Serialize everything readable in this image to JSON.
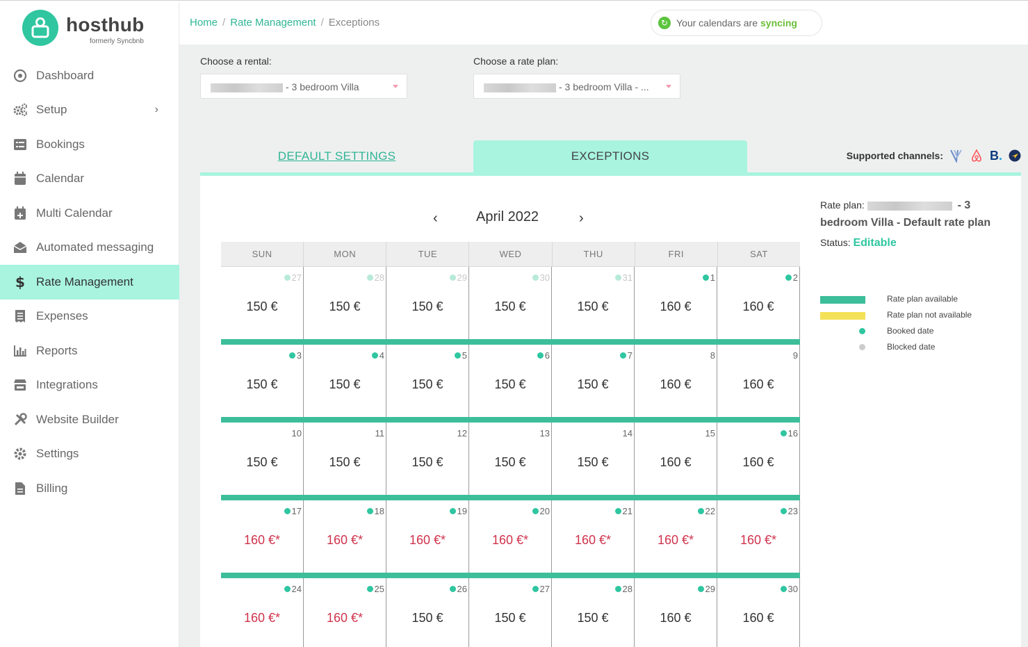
{
  "brand": {
    "name": "hosthub",
    "subtitle": "formerly Syncbnb",
    "accent": "#2fc6a0"
  },
  "sidebar": {
    "items": [
      {
        "label": "Dashboard",
        "icon": "dashboard-icon"
      },
      {
        "label": "Setup",
        "icon": "gears-icon"
      },
      {
        "label": "Bookings",
        "icon": "list-icon"
      },
      {
        "label": "Calendar",
        "icon": "calendar-icon"
      },
      {
        "label": "Multi Calendar",
        "icon": "calendar-plus-icon"
      },
      {
        "label": "Automated messaging",
        "icon": "envelope-icon"
      },
      {
        "label": "Rate Management",
        "icon": "dollar-icon"
      },
      {
        "label": "Expenses",
        "icon": "receipt-icon"
      },
      {
        "label": "Reports",
        "icon": "bar-chart-icon"
      },
      {
        "label": "Integrations",
        "icon": "store-icon"
      },
      {
        "label": "Website Builder",
        "icon": "tools-icon"
      },
      {
        "label": "Settings",
        "icon": "gear-icon"
      },
      {
        "label": "Billing",
        "icon": "file-icon"
      }
    ],
    "active": "Rate Management"
  },
  "header": {
    "breadcrumb": [
      "Home",
      "Rate Management",
      "Exceptions"
    ],
    "sync_text": "Your calendars are",
    "sync_word": "syncing"
  },
  "filters": {
    "rental_label": "Choose a rental:",
    "rental_value": "- 3 bedroom Villa",
    "rateplan_label": "Choose a rate plan:",
    "rateplan_value": "- 3 bedroom Villa - ..."
  },
  "tabs": {
    "default": "DEFAULT SETTINGS",
    "exceptions": "EXCEPTIONS",
    "active": "EXCEPTIONS"
  },
  "channels": {
    "label": "Supported channels:",
    "icons": [
      "vrbo-icon",
      "airbnb-icon",
      "booking-icon",
      "expedia-icon"
    ]
  },
  "calendar": {
    "month": "April 2022",
    "weekdays": [
      "SUN",
      "MON",
      "TUE",
      "WED",
      "THU",
      "FRI",
      "SAT"
    ],
    "weeks": [
      [
        {
          "d": "27",
          "p": "150 €",
          "dot": true,
          "faded": true
        },
        {
          "d": "28",
          "p": "150 €",
          "dot": true,
          "faded": true
        },
        {
          "d": "29",
          "p": "150 €",
          "dot": true,
          "faded": true
        },
        {
          "d": "30",
          "p": "150 €",
          "dot": true,
          "faded": true
        },
        {
          "d": "31",
          "p": "150 €",
          "dot": true,
          "faded": true
        },
        {
          "d": "1",
          "p": "160 €",
          "dot": true
        },
        {
          "d": "2",
          "p": "160 €",
          "dot": true
        }
      ],
      [
        {
          "d": "3",
          "p": "150 €",
          "dot": true
        },
        {
          "d": "4",
          "p": "150 €",
          "dot": true
        },
        {
          "d": "5",
          "p": "150 €",
          "dot": true
        },
        {
          "d": "6",
          "p": "150 €",
          "dot": true
        },
        {
          "d": "7",
          "p": "150 €",
          "dot": true
        },
        {
          "d": "8",
          "p": "160 €"
        },
        {
          "d": "9",
          "p": "160 €"
        }
      ],
      [
        {
          "d": "10",
          "p": "150 €"
        },
        {
          "d": "11",
          "p": "150 €"
        },
        {
          "d": "12",
          "p": "150 €"
        },
        {
          "d": "13",
          "p": "150 €"
        },
        {
          "d": "14",
          "p": "150 €"
        },
        {
          "d": "15",
          "p": "160 €"
        },
        {
          "d": "16",
          "p": "160 €",
          "dot": true
        }
      ],
      [
        {
          "d": "17",
          "p": "160 €*",
          "dot": true,
          "exc": true
        },
        {
          "d": "18",
          "p": "160 €*",
          "dot": true,
          "exc": true
        },
        {
          "d": "19",
          "p": "160 €*",
          "dot": true,
          "exc": true
        },
        {
          "d": "20",
          "p": "160 €*",
          "dot": true,
          "exc": true
        },
        {
          "d": "21",
          "p": "160 €*",
          "dot": true,
          "exc": true
        },
        {
          "d": "22",
          "p": "160 €*",
          "dot": true,
          "exc": true
        },
        {
          "d": "23",
          "p": "160 €*",
          "dot": true,
          "exc": true
        }
      ],
      [
        {
          "d": "24",
          "p": "160 €*",
          "dot": true,
          "exc": true
        },
        {
          "d": "25",
          "p": "160 €*",
          "dot": true,
          "exc": true
        },
        {
          "d": "26",
          "p": "150 €",
          "dot": true
        },
        {
          "d": "27",
          "p": "150 €",
          "dot": true
        },
        {
          "d": "28",
          "p": "150 €",
          "dot": true
        },
        {
          "d": "29",
          "p": "160 €",
          "dot": true
        },
        {
          "d": "30",
          "p": "160 €",
          "dot": true
        }
      ]
    ]
  },
  "info": {
    "rateplan_prefix": "Rate plan:",
    "rateplan_rest": "- 3",
    "rateplan_name": "bedroom Villa - Default rate plan",
    "status_label": "Status:",
    "status_value": "Editable"
  },
  "legend": [
    {
      "label": "Rate plan available",
      "kind": "swatch",
      "color": "#3dbe9b"
    },
    {
      "label": "Rate plan not available",
      "kind": "swatch",
      "color": "#f4e15a"
    },
    {
      "label": "Booked date",
      "kind": "dot",
      "color": "#2fc6a0"
    },
    {
      "label": "Blocked date",
      "kind": "dot",
      "color": "#cccccc"
    }
  ]
}
